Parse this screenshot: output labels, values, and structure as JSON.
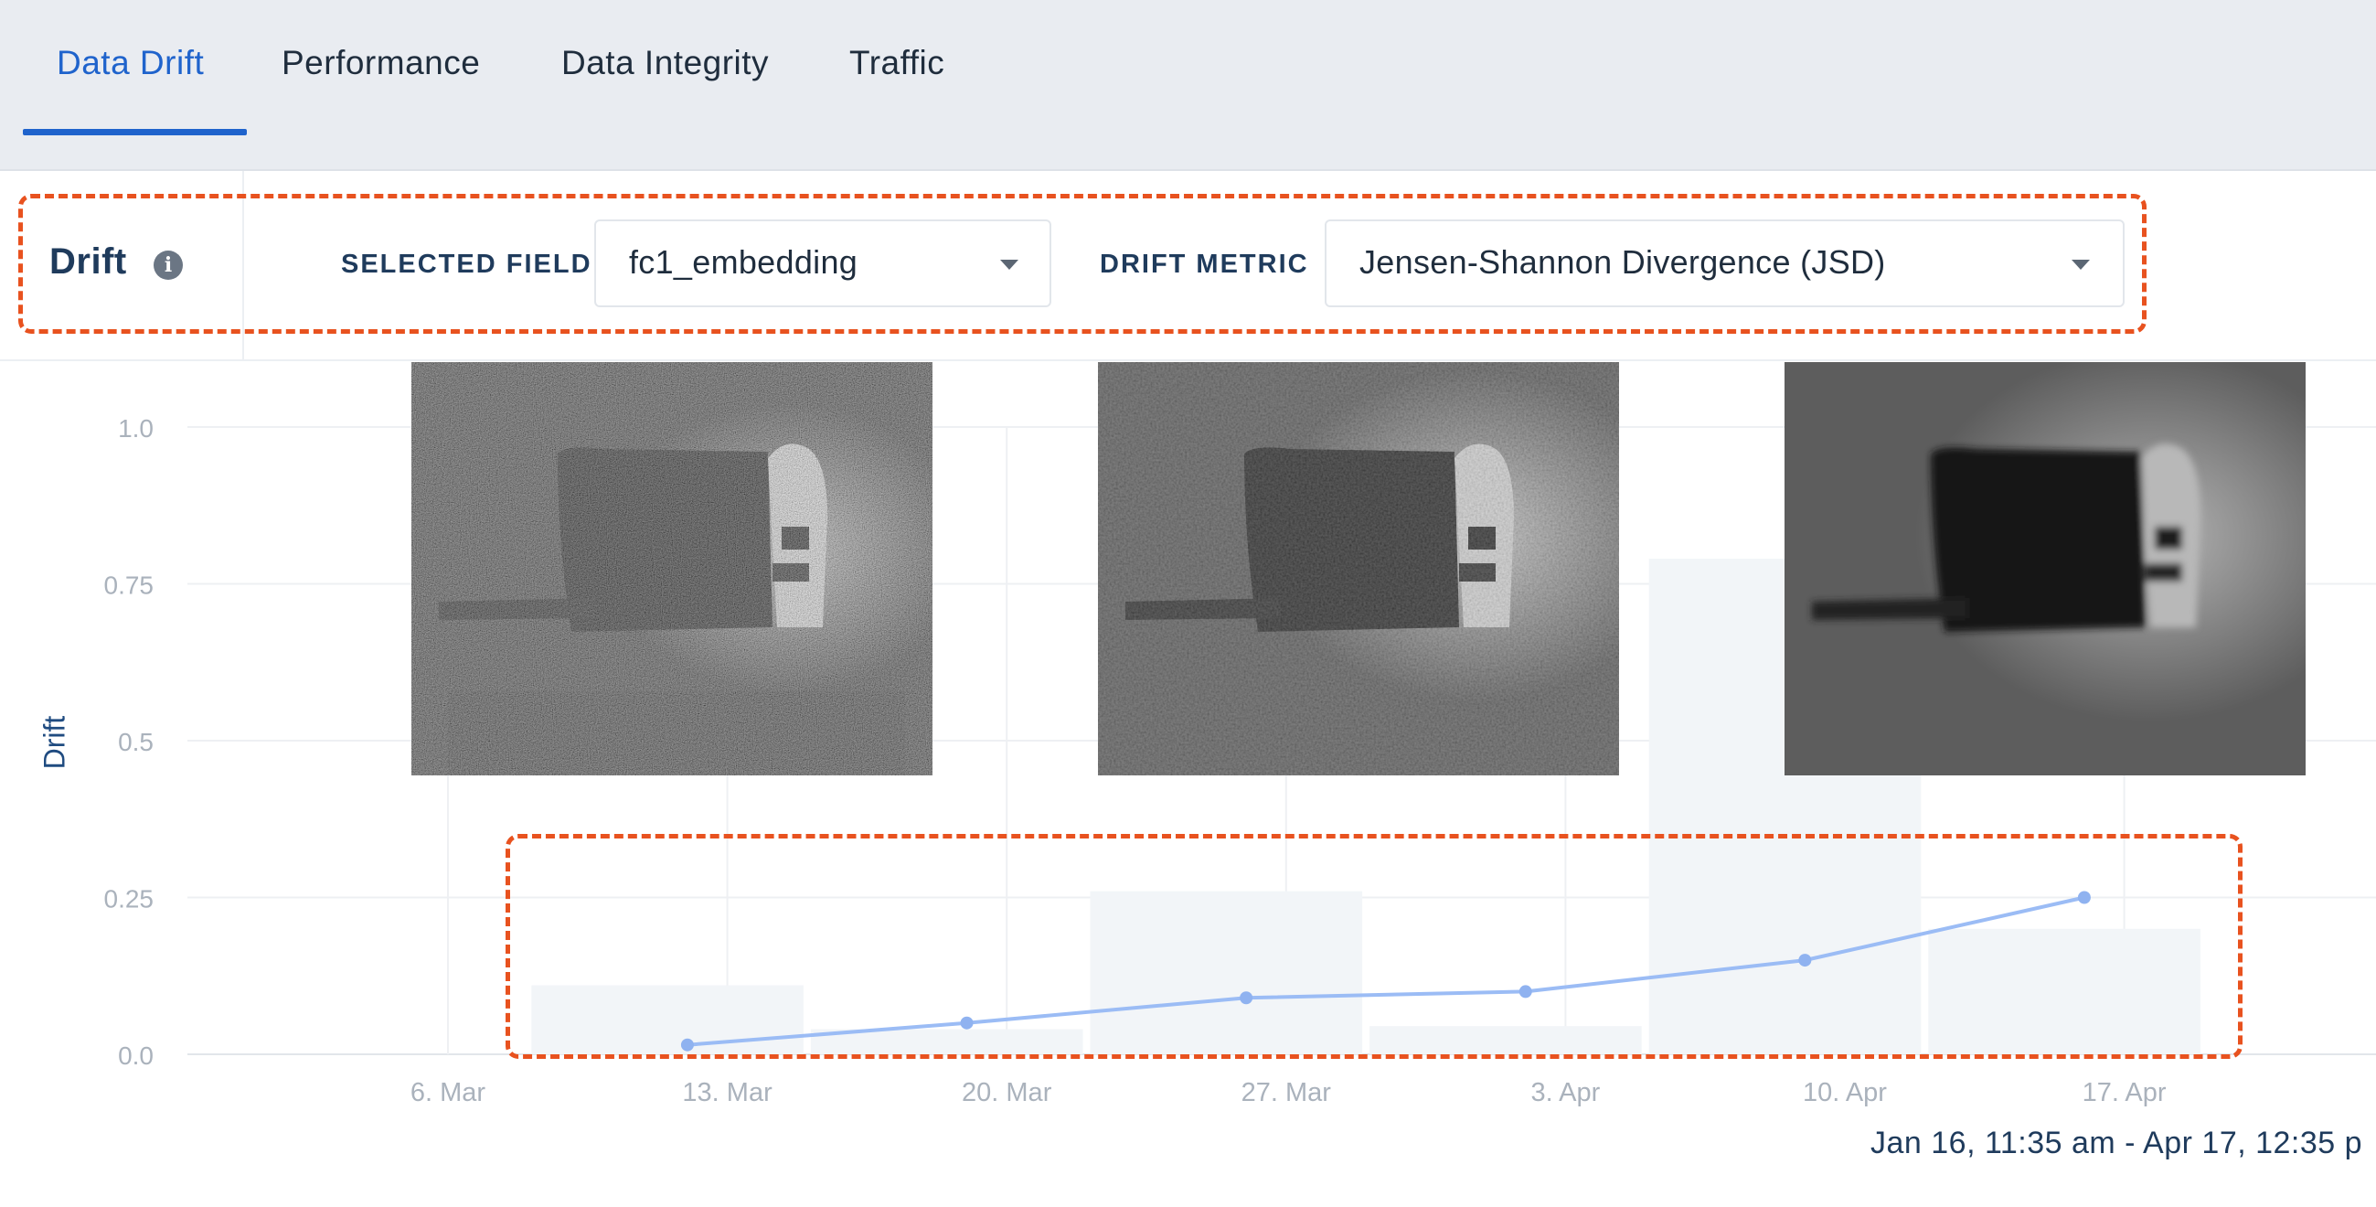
{
  "tabs": [
    {
      "label": "Data Drift",
      "active": true
    },
    {
      "label": "Performance",
      "active": false
    },
    {
      "label": "Data Integrity",
      "active": false
    },
    {
      "label": "Traffic",
      "active": false
    }
  ],
  "drift_panel": {
    "title": "Drift",
    "info_icon": "info-icon",
    "selected_field_label": "SELECTED FIELD",
    "selected_field_value": "fc1_embedding",
    "drift_metric_label": "DRIFT METRIC",
    "drift_metric_value": "Jensen-Shannon Divergence (JSD)"
  },
  "highlight_color": "#e8521f",
  "accent_color": "#1f63cc",
  "date_range": "Jan 16, 11:35 am - Apr 17, 12:35 p",
  "chart_data": {
    "type": "line",
    "ylabel": "Drift",
    "yticks": [
      "1.0",
      "0.75",
      "0.5",
      "0.25",
      "0.0"
    ],
    "ylim": [
      0,
      1
    ],
    "xticks": [
      "6. Mar",
      "13. Mar",
      "20. Mar",
      "27. Mar",
      "3. Apr",
      "10. Apr",
      "17. Apr"
    ],
    "grid": true,
    "series": [
      {
        "x": [
          "2023-03-12",
          "2023-03-19",
          "2023-03-26",
          "2023-04-02",
          "2023-04-09",
          "2023-04-16"
        ],
        "values": [
          0.015,
          0.05,
          0.09,
          0.1,
          0.15,
          0.25
        ],
        "color": "#9bbcf5"
      }
    ],
    "histogram_bars": {
      "bins": [
        [
          "2023-03-08",
          "2023-03-15"
        ],
        [
          "2023-03-15",
          "2023-03-22"
        ],
        [
          "2023-03-22",
          "2023-03-29"
        ],
        [
          "2023-03-29",
          "2023-04-05"
        ],
        [
          "2023-04-05",
          "2023-04-12"
        ],
        [
          "2023-04-12",
          "2023-04-19"
        ]
      ],
      "values": [
        0.11,
        0.04,
        0.26,
        0.045,
        0.79,
        0.2
      ],
      "color": "#f2f5f8"
    }
  },
  "images": [
    {
      "name": "sonar-image-noisy",
      "style": "noisy"
    },
    {
      "name": "sonar-image-medium",
      "style": "medium"
    },
    {
      "name": "sonar-image-smooth",
      "style": "smooth"
    }
  ]
}
